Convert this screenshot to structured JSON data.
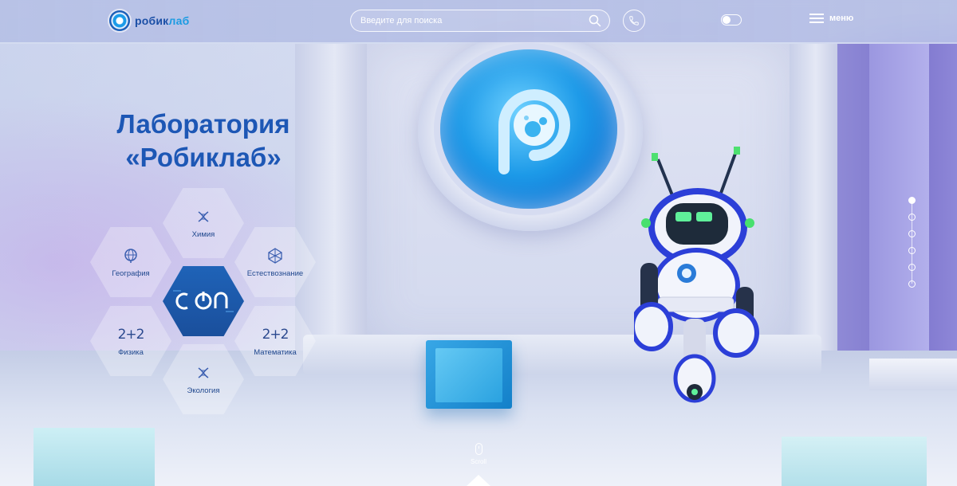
{
  "header": {
    "logo_text_main": "робик",
    "logo_text_accent": "лаб",
    "search_placeholder": "Введите для поиска",
    "menu_label": "меню"
  },
  "hero": {
    "title_line1": "Лаборатория",
    "title_line2": "«Робиклаб»"
  },
  "subjects": [
    {
      "label": "Химия",
      "icon": "dna-icon"
    },
    {
      "label": "География",
      "icon": "globe-icon"
    },
    {
      "label": "Естествознание",
      "icon": "molecule-icon"
    },
    {
      "label": "Физика",
      "icon": "math-icon",
      "glyph": "2+2"
    },
    {
      "label": "Математика",
      "icon": "math-icon",
      "glyph": "2+2"
    },
    {
      "label": "Экология",
      "icon": "dna-icon"
    }
  ],
  "center_hex": {
    "logo_text": "CON",
    "icon": "con-logo-icon"
  },
  "pagination": {
    "count": 6,
    "active_index": 0
  },
  "scroll": {
    "label": "Scroll"
  },
  "colors": {
    "brand_blue": "#1d57b5",
    "accent_blue": "#1b9be2",
    "center_hex_bg": "#1f63b8"
  }
}
